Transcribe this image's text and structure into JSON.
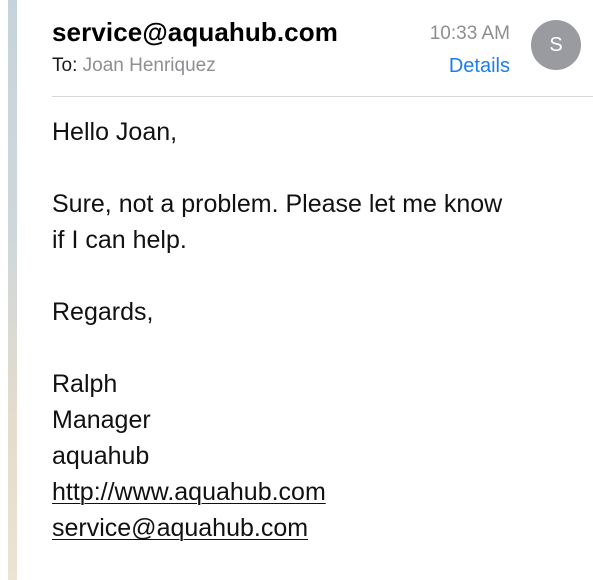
{
  "email": {
    "sender": "service@aquahub.com",
    "to_label": "To:",
    "to_name": "Joan Henriquez",
    "time": "10:33 AM",
    "details_label": "Details",
    "avatar_initial": "S"
  },
  "body": {
    "greeting": "Hello Joan,",
    "message_line1": "Sure, not a problem.  Please let me know",
    "message_line2": "if I can help.",
    "closing": "Regards,",
    "signature": {
      "name": "Ralph",
      "title": "Manager",
      "company": "aquahub",
      "website": "http://www.aquahub.com",
      "email": "service@aquahub.com"
    }
  },
  "colors": {
    "accent": "#1c7ee8",
    "muted": "#8e8e93",
    "avatar_bg": "#9a9ba1"
  }
}
